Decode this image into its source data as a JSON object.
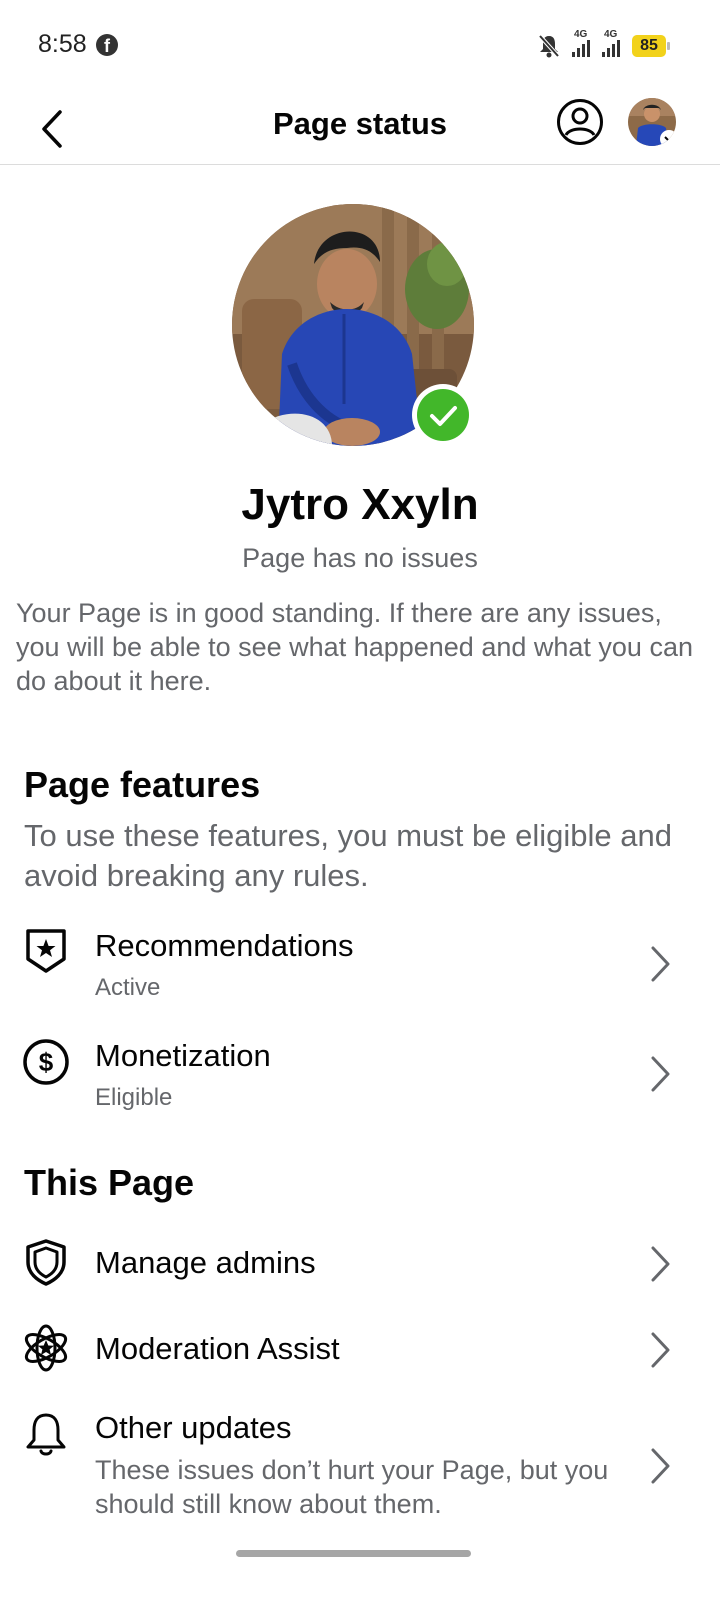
{
  "status_bar": {
    "time": "8:58",
    "app_icon": "facebook-icon",
    "network": [
      "4G",
      "4G"
    ],
    "battery": "85",
    "battery_color": "#f2d21b"
  },
  "header": {
    "title": "Page status",
    "back_icon": "back-arrow-icon",
    "profile_icon": "profile-icon"
  },
  "page": {
    "name": "Jytro Xxyln",
    "status": "Page has no issues",
    "standing": "Your Page is in good standing. If there are any issues, you will be able to see what happened and what you can do about it here.",
    "verified_color": "#42b72a"
  },
  "features": {
    "title": "Page features",
    "description": "To use these features, you must be eligible and avoid breaking any rules.",
    "items": [
      {
        "label": "Recommendations",
        "status": "Active",
        "icon": "recommendation-badge-icon"
      },
      {
        "label": "Monetization",
        "status": "Eligible",
        "icon": "dollar-icon"
      }
    ]
  },
  "this_page": {
    "title": "This Page",
    "items": [
      {
        "label": "Manage admins",
        "icon": "shield-icon"
      },
      {
        "label": "Moderation Assist",
        "icon": "atom-star-icon"
      },
      {
        "label": "Other updates",
        "description": "These issues don’t hurt your Page, but you should still know about them.",
        "icon": "bell-icon"
      }
    ]
  }
}
